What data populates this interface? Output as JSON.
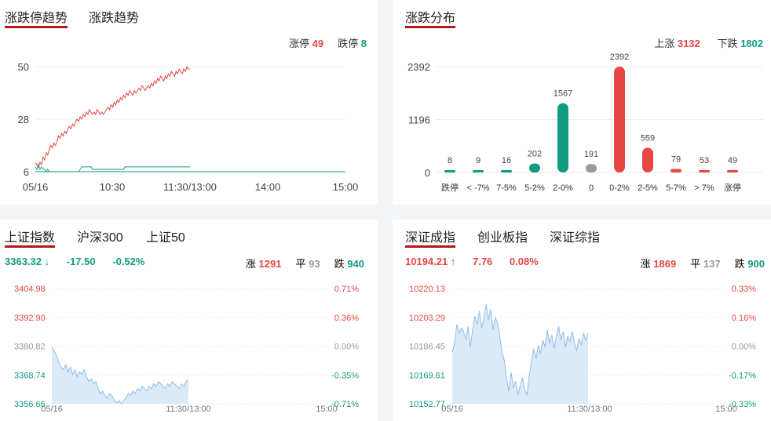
{
  "colors": {
    "up": "#e84545",
    "down": "#119b80",
    "flat": "#999999",
    "accent": "#b3161b",
    "area": "#dbeaf9",
    "area_line": "#8fbde6"
  },
  "limit_panel": {
    "tabs": [
      "涨跌停趋势",
      "涨跌趋势"
    ],
    "active_tab": 0,
    "up_label": "涨停",
    "up_count": "49",
    "down_label": "跌停",
    "down_count": "8",
    "chart_data": {
      "type": "line",
      "title": "",
      "y_ticks": [
        "50",
        "28",
        "6"
      ],
      "ylim": [
        6,
        50
      ],
      "x_ticks": [
        "05/16",
        "10:30",
        "11:30/13:00",
        "14:00",
        "15:00"
      ],
      "series": [
        {
          "name": "涨停",
          "color": "#e84545",
          "values": [
            10,
            9,
            8,
            10,
            9,
            12,
            11,
            14,
            13,
            15,
            17,
            16,
            18,
            17,
            19,
            21,
            20,
            22,
            21,
            23,
            22,
            24,
            25,
            24,
            26,
            25,
            27,
            28,
            27,
            29,
            28,
            30,
            29,
            31,
            30,
            32,
            31,
            30,
            31,
            30,
            32,
            31,
            30,
            31,
            30,
            31,
            32,
            33,
            32,
            34,
            33,
            35,
            34,
            36,
            35,
            37,
            36,
            38,
            37,
            39,
            38,
            40,
            39,
            38,
            40,
            39,
            40,
            41,
            40,
            42,
            41,
            40,
            41,
            42,
            41,
            43,
            42,
            44,
            43,
            45,
            44,
            46,
            45,
            44,
            46,
            45,
            47,
            46,
            48,
            47,
            46,
            48,
            47,
            49,
            48,
            47,
            49,
            48,
            50,
            49,
            49
          ]
        },
        {
          "name": "跌停",
          "color": "#119b80",
          "values": [
            8,
            7,
            9,
            7,
            8,
            7,
            7,
            6,
            7,
            6,
            6,
            6,
            6,
            6,
            6,
            6,
            6,
            6,
            6,
            6,
            6,
            6,
            6,
            6,
            6,
            6,
            6,
            6,
            6,
            7,
            8,
            8,
            8,
            8,
            8,
            8,
            8,
            7,
            7,
            7,
            7,
            7,
            7,
            7,
            7,
            7,
            7,
            7,
            7,
            7,
            7,
            7,
            7,
            7,
            7,
            7,
            7,
            7,
            8,
            8,
            8,
            8,
            8,
            8,
            8,
            8,
            8,
            8,
            8,
            8,
            8,
            8,
            8,
            8,
            8,
            8,
            8,
            8,
            8,
            8,
            8,
            8,
            8,
            8,
            8,
            8,
            8,
            8,
            8,
            8,
            8,
            8,
            8,
            8,
            8,
            8,
            8,
            8,
            8,
            8,
            8
          ]
        }
      ]
    }
  },
  "dist_panel": {
    "tabs": [
      "涨跌分布"
    ],
    "active_tab": 0,
    "up_label": "上涨",
    "up_count": "3132",
    "down_label": "下跌",
    "down_count": "1802",
    "chart_data": {
      "type": "bar",
      "title": "",
      "y_ticks": [
        "2392",
        "1196",
        "0"
      ],
      "ylim": [
        0,
        2392
      ],
      "categories": [
        "跌停",
        "< -7%",
        "7-5%",
        "5-2%",
        "2-0%",
        "0",
        "0-2%",
        "2-5%",
        "5-7%",
        "> 7%",
        "涨停"
      ],
      "values": [
        8,
        9,
        16,
        202,
        1567,
        191,
        2392,
        559,
        79,
        53,
        49
      ],
      "value_labels": [
        "8",
        "9",
        "16",
        "202",
        "1567",
        "191",
        "2392",
        "559",
        "79",
        "53",
        "49"
      ],
      "bar_colors": [
        "#119b80",
        "#119b80",
        "#119b80",
        "#119b80",
        "#119b80",
        "#999999",
        "#e84545",
        "#e84545",
        "#e84545",
        "#e84545",
        "#e84545"
      ]
    }
  },
  "sh_panel": {
    "tabs": [
      "上证指数",
      "沪深300",
      "上证50"
    ],
    "active_tab": 0,
    "price": "3363.32",
    "arrow": "↓",
    "change": "-17.50",
    "change_pct": "-0.52%",
    "up_label": "涨",
    "up_count": "1291",
    "flat_label": "平",
    "flat_count": "93",
    "down_label": "跌",
    "down_count": "940",
    "chart_data": {
      "type": "area",
      "title": "",
      "y_ticks_left": [
        "3404.98",
        "3392.90",
        "3380.82",
        "3368.74",
        "3356.66"
      ],
      "y_ticks_right": [
        "0.71%",
        "0.36%",
        "0.00%",
        "-0.35%",
        "-0.71%"
      ],
      "ylim": [
        3356.66,
        3404.98
      ],
      "x_ticks": [
        "05/16",
        "11:30/13:00",
        "15:00"
      ],
      "values": [
        3380.5,
        3379,
        3377,
        3374,
        3372,
        3371,
        3373,
        3370,
        3372,
        3369,
        3371,
        3368,
        3370,
        3369,
        3371,
        3368,
        3366,
        3367,
        3365,
        3366,
        3363,
        3361,
        3362,
        3360,
        3359,
        3361,
        3360,
        3358,
        3357,
        3358,
        3356.7,
        3358,
        3359,
        3361,
        3360,
        3362,
        3361,
        3363,
        3362,
        3364,
        3363,
        3362,
        3364,
        3363,
        3365,
        3364,
        3366,
        3365,
        3364,
        3363,
        3365,
        3364,
        3366,
        3365,
        3364,
        3363,
        3365,
        3364,
        3366,
        3367
      ]
    }
  },
  "sz_panel": {
    "tabs": [
      "深证成指",
      "创业板指",
      "深证综指"
    ],
    "active_tab": 0,
    "price": "10194.21",
    "arrow": "↑",
    "change": "7.76",
    "change_pct": "0.08%",
    "up_label": "涨",
    "up_count": "1869",
    "flat_label": "平",
    "flat_count": "137",
    "down_label": "跌",
    "down_count": "900",
    "chart_data": {
      "type": "area",
      "title": "",
      "y_ticks_left": [
        "10220.13",
        "10203.29",
        "10186.45",
        "10169.61",
        "10152.77"
      ],
      "y_ticks_right": [
        "0.33%",
        "0.16%",
        "0.00%",
        "-0.17%",
        "-0.33%"
      ],
      "ylim": [
        10152.77,
        10220.13
      ],
      "x_ticks": [
        "05/16",
        "11:30/13:00",
        "15:00"
      ],
      "values": [
        10183,
        10188,
        10199,
        10194,
        10197,
        10195,
        10190,
        10198,
        10186,
        10196,
        10204,
        10199,
        10207,
        10197,
        10203,
        10211,
        10202,
        10208,
        10196,
        10203,
        10200,
        10192,
        10183,
        10178,
        10168,
        10160,
        10171,
        10162,
        10166,
        10158,
        10163,
        10168,
        10161,
        10158,
        10169,
        10177,
        10185,
        10179,
        10187,
        10182,
        10190,
        10186,
        10196,
        10188,
        10193,
        10185,
        10192,
        10198,
        10190,
        10195,
        10186,
        10192,
        10189,
        10195,
        10188,
        10184,
        10191,
        10187,
        10194,
        10190,
        10194
      ]
    }
  }
}
